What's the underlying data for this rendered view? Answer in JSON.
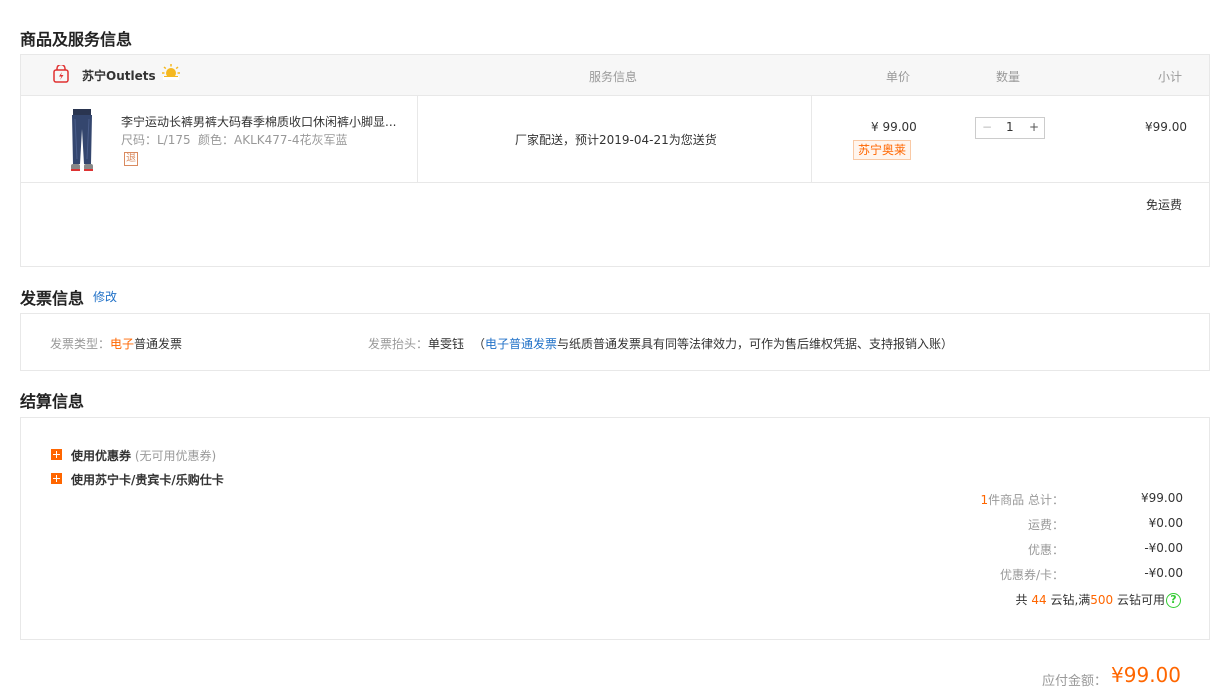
{
  "sections": {
    "goods_title": "商品及服务信息",
    "invoice_title": "发票信息",
    "invoice_edit": "修改",
    "settlement_title": "结算信息"
  },
  "table": {
    "store_name": "苏宁Outlets",
    "col_service": "服务信息",
    "col_price": "单价",
    "col_qty": "数量",
    "col_subtotal": "小计"
  },
  "item": {
    "name": "李宁运动长裤男裤大码春季棉质收口休闲裤小脚显...",
    "size_label": "尺码：L/175",
    "color_label": "颜色：AKLK477-4花灰军蓝",
    "return_badge": "退",
    "service": "厂家配送，预计2019-04-21为您送货",
    "price": "¥ 99.00",
    "tag": "苏宁奥莱",
    "qty": "1",
    "qty_minus": "−",
    "qty_plus": "+",
    "subtotal": "¥99.00",
    "shipping": "免运费"
  },
  "invoice": {
    "type_label": "发票类型：",
    "type_prefix": "电子",
    "type_suffix": "普通发票",
    "head_label": "发票抬头：",
    "head_value": "单雯钰",
    "note_open": "（",
    "note_link": "电子普通发票",
    "note_text": "与纸质普通发票具有同等法律效力，可作为售后维权凭据、支持报销入账）"
  },
  "settlement": {
    "coupon_label": "使用优惠券",
    "coupon_note": "(无可用优惠券)",
    "card_label": "使用苏宁卡/贵宾卡/乐购仕卡",
    "items_count": "1",
    "items_total_label": "件商品 总计：",
    "items_total": "¥99.00",
    "freight_label": "运费：",
    "freight": "¥0.00",
    "discount_label": "优惠：",
    "discount": "-¥0.00",
    "coupon_card_label": "优惠券/卡：",
    "coupon_card": "-¥0.00",
    "diamond_prefix": "共 ",
    "diamond_count": "44",
    "diamond_mid": " 云钻,满",
    "diamond_threshold": "500",
    "diamond_suffix": " 云钻可用",
    "help_icon": "?"
  },
  "footer": {
    "pay_label": "应付金额：",
    "pay_amount": "¥99.00"
  },
  "colors": {
    "accent": "#ff6600",
    "link": "#2272c8",
    "border": "#e8e8e8"
  },
  "icons": [
    "store-bag-icon",
    "sun-badge-icon",
    "jeans-product-image",
    "plus-square-icon",
    "help-circle-icon"
  ]
}
